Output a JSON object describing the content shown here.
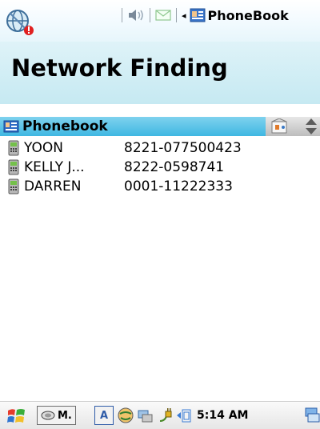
{
  "topbar": {
    "app_name": "PhoneBook",
    "arrow": "◂"
  },
  "page": {
    "title": "Network Finding"
  },
  "list": {
    "header": "Phonebook",
    "rows": [
      {
        "name": "YOON",
        "number": "8221-077500423"
      },
      {
        "name": "KELLY J...",
        "number": "8222-0598741"
      },
      {
        "name": "DARREN",
        "number": "0001-11222333"
      }
    ]
  },
  "taskbar": {
    "app_label": "M.",
    "input_label": "A",
    "time": "5:14 AM"
  },
  "colors": {
    "accent": "#3fb7e2",
    "title_band": "#d2eef5"
  }
}
